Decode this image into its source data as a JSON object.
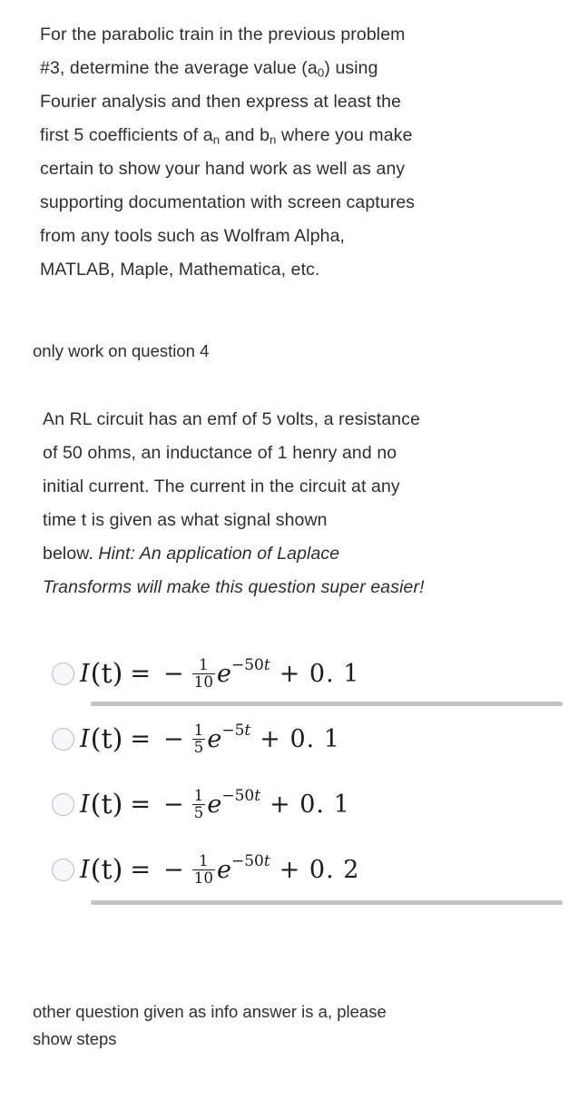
{
  "document": {
    "problem_paragraph": {
      "line1": "For the parabolic train in the previous problem",
      "line2_a": "#3, determine the average value (a",
      "line2_sub": "0",
      "line2_b": ")  using",
      "line3": "Fourier analysis and then express at least the",
      "line4_a": "first 5 coefficients of a",
      "line4_sub1": "n",
      "line4_b": " and b",
      "line4_sub2": "n",
      "line4_c": " where you make",
      "line5": "certain to show your hand work as well as any",
      "line6": "supporting documentation with screen captures",
      "line7": "from any tools such as Wolfram Alpha,",
      "line8": "MATLAB, Maple, Mathematica, etc."
    },
    "instruction_top": "only work on question 4",
    "rl_question": {
      "line1": "An RL circuit has an emf of 5 volts, a resistance",
      "line2": "of 50 ohms, an inductance of 1 henry and no",
      "line3": "initial current. The current in the circuit at any",
      "line4": "time t is given as what signal shown",
      "line5_plain": "below.  ",
      "line5_italic": "Hint:  An application of Laplace",
      "line6_italic": "Transforms will make this question super easier!"
    },
    "instruction_bottom": {
      "line1": "other question given as info answer is a, please",
      "line2": "show steps"
    }
  },
  "answer_options": [
    {
      "id": "option-a",
      "selected": false,
      "lhs": "I",
      "arg": "(t)",
      "equals": "=",
      "sign": "−",
      "fraction_numerator": "1",
      "fraction_denominator": "10",
      "exp_base": "e",
      "exp_sign": "−",
      "exp_coefficient": "50",
      "exp_variable": "t",
      "tail": "+ 0. 1",
      "divider_below": true
    },
    {
      "id": "option-b",
      "selected": false,
      "lhs": "I",
      "arg": "(t)",
      "equals": "=",
      "sign": "−",
      "fraction_numerator": "1",
      "fraction_denominator": "5",
      "exp_base": "e",
      "exp_sign": "−",
      "exp_coefficient": "5",
      "exp_variable": "t",
      "tail": "+ 0. 1",
      "divider_below": false
    },
    {
      "id": "option-c",
      "selected": false,
      "lhs": "I",
      "arg": "(t)",
      "equals": "=",
      "sign": "−",
      "fraction_numerator": "1",
      "fraction_denominator": "5",
      "exp_base": "e",
      "exp_sign": "−",
      "exp_coefficient": "50",
      "exp_variable": "t",
      "tail": "+ 0. 1",
      "divider_below": false
    },
    {
      "id": "option-d",
      "selected": false,
      "lhs": "I",
      "arg": "(t)",
      "equals": "=",
      "sign": "−",
      "fraction_numerator": "1",
      "fraction_denominator": "10",
      "exp_base": "e",
      "exp_sign": "−",
      "exp_coefficient": "50",
      "exp_variable": "t",
      "tail": "+ 0. 2",
      "divider_below": true
    }
  ],
  "style": {
    "background": "#ffffff",
    "text_color": "#2e2e2e",
    "math_color": "#1c1c1c",
    "divider_color": "#c4c4c4",
    "radio_border": "#b9bcc2",
    "radio_fill": "#f7f8fa"
  }
}
